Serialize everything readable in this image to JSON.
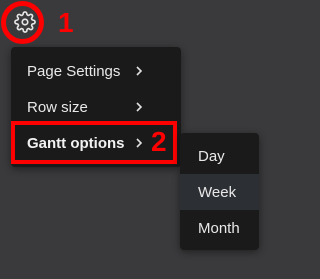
{
  "toolbar": {
    "settings_icon": "gear-icon"
  },
  "annotations": {
    "step1": "1",
    "step2": "2",
    "color": "#ff0000"
  },
  "menu": {
    "items": [
      {
        "label": "Page Settings",
        "has_submenu": true
      },
      {
        "label": "Row size",
        "has_submenu": true
      },
      {
        "label": "Gantt options",
        "has_submenu": true,
        "active": true
      }
    ]
  },
  "submenu": {
    "items": [
      {
        "label": "Day"
      },
      {
        "label": "Week",
        "hovered": true
      },
      {
        "label": "Month"
      }
    ]
  }
}
